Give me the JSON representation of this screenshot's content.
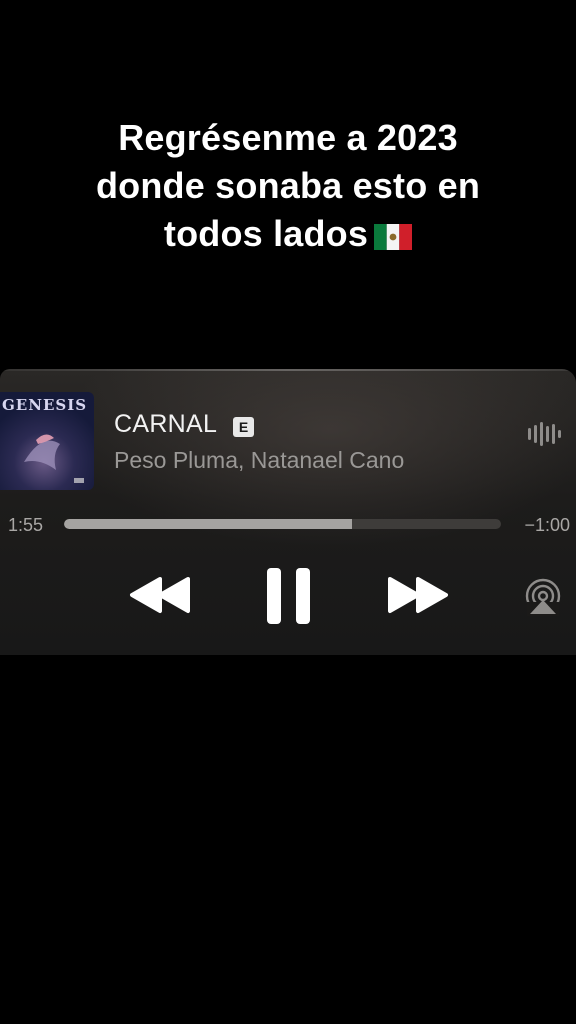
{
  "caption": {
    "line1": "Regrésenme a 2023",
    "line2": "donde sonaba esto en",
    "line3": "todos lados",
    "flag_icon": "mexico-flag-icon"
  },
  "player": {
    "album_art_text": "GENESIS",
    "title": "CARNAL",
    "explicit_badge": "E",
    "artist": "Peso Pluma, Natanael Cano",
    "elapsed": "1:55",
    "remaining": "−1:00",
    "progress": 0.66,
    "icons": {
      "audio": "waveform-icon",
      "rewind": "rewind-icon",
      "pause": "pause-icon",
      "forward": "fast-forward-icon",
      "airplay": "airplay-icon"
    },
    "colors": {
      "progress_fill": "#a5a3a1",
      "progress_track": "#3e3c3a"
    }
  }
}
